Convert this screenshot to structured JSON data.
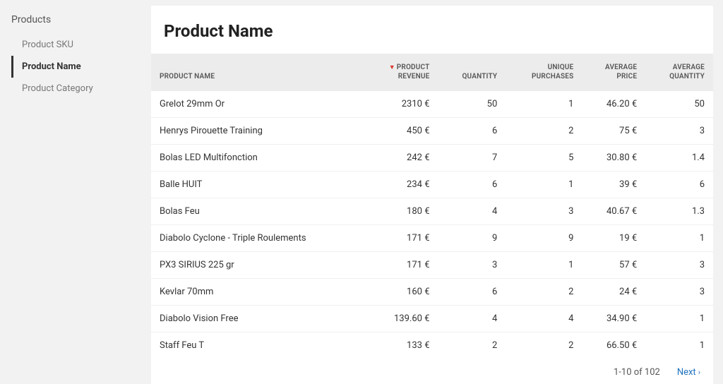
{
  "sidebar": {
    "heading": "Products",
    "items": [
      {
        "label": "Product SKU",
        "active": false
      },
      {
        "label": "Product Name",
        "active": true
      },
      {
        "label": "Product Category",
        "active": false
      }
    ]
  },
  "page": {
    "title": "Product Name"
  },
  "table": {
    "columns": [
      {
        "line1": "PRODUCT NAME",
        "line2": "",
        "sorted": false
      },
      {
        "line1": "PRODUCT",
        "line2": "REVENUE",
        "sorted": true
      },
      {
        "line1": "QUANTITY",
        "line2": "",
        "sorted": false
      },
      {
        "line1": "UNIQUE",
        "line2": "PURCHASES",
        "sorted": false
      },
      {
        "line1": "AVERAGE",
        "line2": "PRICE",
        "sorted": false
      },
      {
        "line1": "AVERAGE",
        "line2": "QUANTITY",
        "sorted": false
      }
    ],
    "rows": [
      {
        "name": "Grelot 29mm Or",
        "revenue": "2310 €",
        "quantity": "50",
        "unique": "1",
        "avg_price": "46.20 €",
        "avg_qty": "50"
      },
      {
        "name": "Henrys Pirouette Training",
        "revenue": "450 €",
        "quantity": "6",
        "unique": "2",
        "avg_price": "75 €",
        "avg_qty": "3"
      },
      {
        "name": "Bolas LED Multifonction",
        "revenue": "242 €",
        "quantity": "7",
        "unique": "5",
        "avg_price": "30.80 €",
        "avg_qty": "1.4"
      },
      {
        "name": "Balle HUIT",
        "revenue": "234 €",
        "quantity": "6",
        "unique": "1",
        "avg_price": "39 €",
        "avg_qty": "6"
      },
      {
        "name": "Bolas Feu",
        "revenue": "180 €",
        "quantity": "4",
        "unique": "3",
        "avg_price": "40.67 €",
        "avg_qty": "1.3"
      },
      {
        "name": "Diabolo Cyclone - Triple Roulements",
        "revenue": "171 €",
        "quantity": "9",
        "unique": "9",
        "avg_price": "19 €",
        "avg_qty": "1"
      },
      {
        "name": "PX3 SIRIUS 225 gr",
        "revenue": "171 €",
        "quantity": "3",
        "unique": "1",
        "avg_price": "57 €",
        "avg_qty": "3"
      },
      {
        "name": "Kevlar 70mm",
        "revenue": "160 €",
        "quantity": "6",
        "unique": "2",
        "avg_price": "24 €",
        "avg_qty": "3"
      },
      {
        "name": "Diabolo Vision Free",
        "revenue": "139.60 €",
        "quantity": "4",
        "unique": "4",
        "avg_price": "34.90 €",
        "avg_qty": "1"
      },
      {
        "name": "Staff Feu T",
        "revenue": "133 €",
        "quantity": "2",
        "unique": "2",
        "avg_price": "66.50 €",
        "avg_qty": "1"
      }
    ]
  },
  "pager": {
    "range": "1-10 of 102",
    "next": "Next"
  }
}
